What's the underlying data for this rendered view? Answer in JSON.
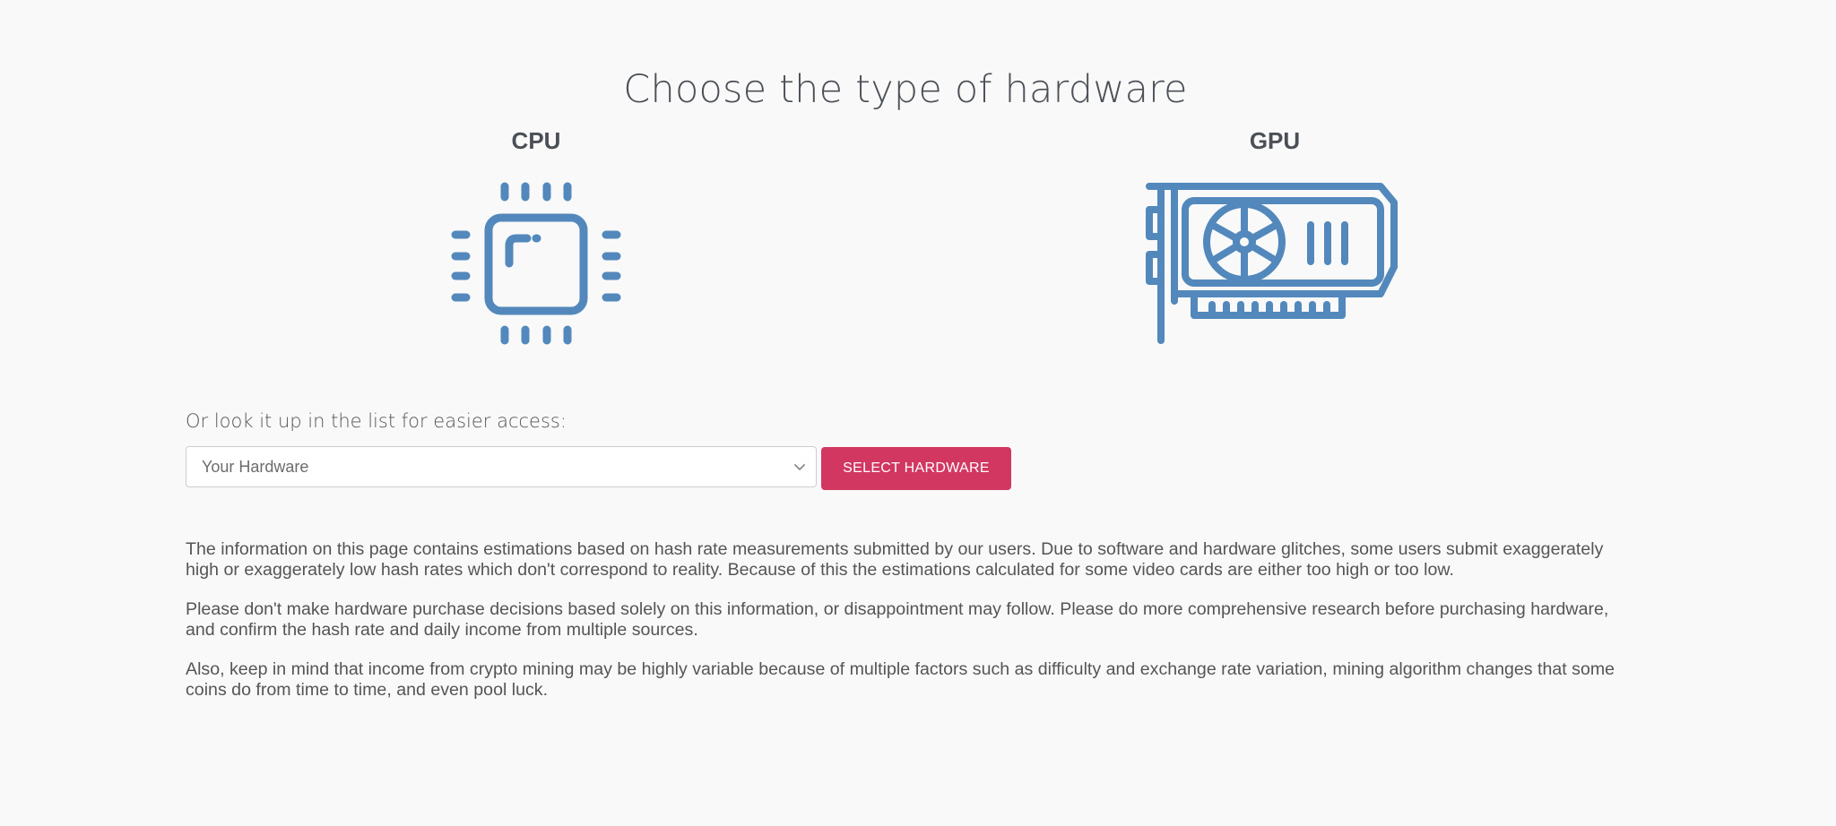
{
  "page": {
    "title": "Choose the type of hardware"
  },
  "hardware_types": {
    "cpu": {
      "label": "CPU",
      "icon": "cpu-chip-icon"
    },
    "gpu": {
      "label": "GPU",
      "icon": "graphics-card-icon"
    }
  },
  "lookup": {
    "label": "Or look it up in the list for easier access:",
    "select_value": "Your Hardware",
    "button_label": "SELECT HARDWARE"
  },
  "disclaimer": {
    "paragraphs": [
      "The information on this page contains estimations based on hash rate measurements submitted by our users. Due to software and hardware glitches, some users submit exaggerately high or exaggerately low hash rates which don't correspond to reality. Because of this the estimations calculated for some video cards are either too high or too low.",
      "Please don't make hardware purchase decisions based solely on this information, or disappointment may follow. Please do more comprehensive research before purchasing hardware, and confirm the hash rate and daily income from multiple sources.",
      "Also, keep in mind that income from crypto mining may be highly variable because of multiple factors such as difficulty and exchange rate variation, mining algorithm changes that some coins do from time to time, and even pool luck."
    ]
  },
  "colors": {
    "icon": "#5288bb",
    "accent_button": "#d23762",
    "background": "#f9f9fa",
    "title_text": "#4b4f56"
  }
}
